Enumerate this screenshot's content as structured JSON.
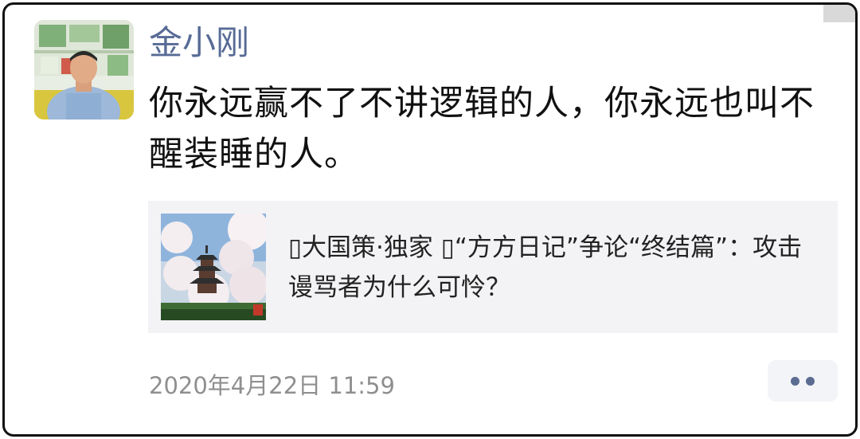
{
  "post": {
    "author_name": "金小刚",
    "text": "你永远赢不了不讲逻辑的人，你永远也叫不醒装睡的人。",
    "timestamp": "2020年4月22日 11:59"
  },
  "link_card": {
    "title": "▯大国策·独家 ▯“方方日记”争论“终结篇”：攻击谩骂者为什么可怜？",
    "thumbnail_icon": "cherry-blossom-pagoda-image"
  },
  "actions": {
    "more_icon": "more-dots-icon"
  },
  "colors": {
    "name": "#586b96",
    "card_bg": "#f3f3f5",
    "timestamp": "#8f8f8f",
    "dots": "#5b6b91"
  }
}
